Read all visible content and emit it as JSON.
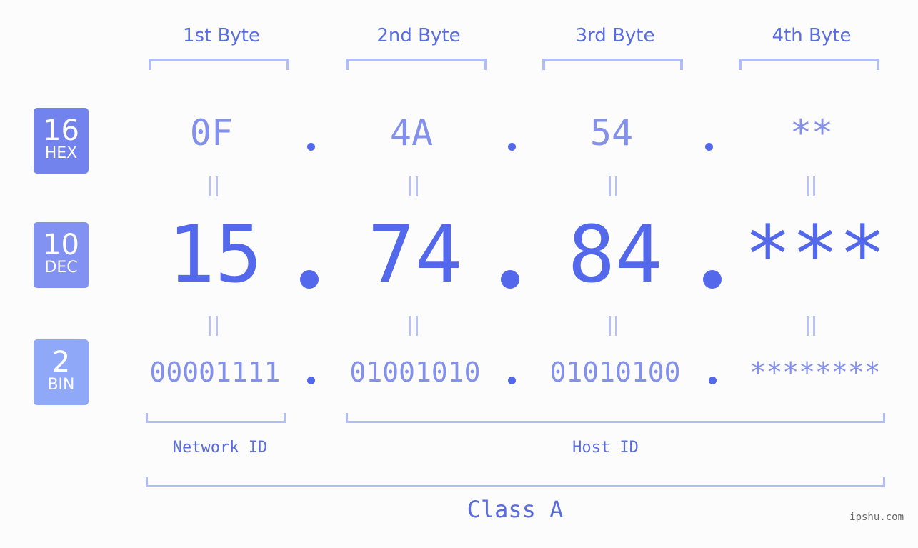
{
  "bases": [
    {
      "number": "16",
      "label": "HEX",
      "color": "#7383ee"
    },
    {
      "number": "10",
      "label": "DEC",
      "color": "#8292f2"
    },
    {
      "number": "2",
      "label": "BIN",
      "color": "#8fa8f8"
    }
  ],
  "byte_headers": [
    "1st Byte",
    "2nd Byte",
    "3rd Byte",
    "4th Byte"
  ],
  "hex": [
    "0F",
    "4A",
    "54",
    "**"
  ],
  "dec": [
    "15",
    "74",
    "84",
    "***"
  ],
  "bin": [
    "00001111",
    "01001010",
    "01010100",
    "********"
  ],
  "separator": ".",
  "network_id_label": "Network ID",
  "host_id_label": "Host ID",
  "class_label": "Class A",
  "watermark": "ipshu.com",
  "colors": {
    "accent": "#5468eb",
    "light_text": "#8390ec",
    "bracket": "#b2bcf5",
    "background": "#fbfcfb"
  }
}
